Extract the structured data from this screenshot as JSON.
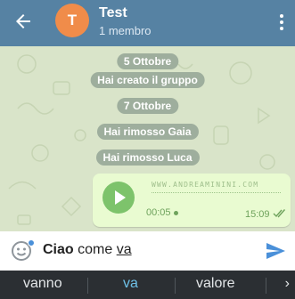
{
  "header": {
    "title": "Test",
    "subtitle": "1 membro",
    "avatar_letter": "T",
    "avatar_color": "#f08c4a",
    "bar_color": "#5682a3"
  },
  "chat": {
    "service_messages": [
      "5 Ottobre",
      "Hai creato il gruppo",
      "7 Ottobre",
      "Hai rimosso Gaia",
      "Hai rimosso Luca"
    ],
    "voice_message": {
      "watermark": "WWW.ANDREAMININI.COM",
      "duration": "00:05",
      "time": "15:09",
      "status": "read"
    }
  },
  "input": {
    "text_bold": "Ciao",
    "text_plain": " come ",
    "text_underlined": "va"
  },
  "suggestions": {
    "items": [
      "vanno",
      "va",
      "valore"
    ],
    "more": "›"
  },
  "colors": {
    "accent": "#4a90d9",
    "play_button": "#7dc36b",
    "outgoing_bubble": "#e9fbd1"
  }
}
